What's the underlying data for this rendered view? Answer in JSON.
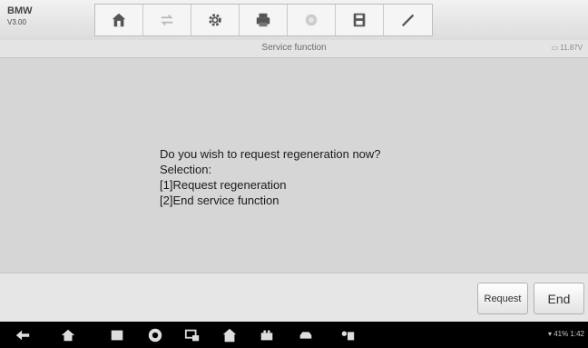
{
  "vehicle": {
    "make": "BMW",
    "version": "V3.00"
  },
  "toolbar": {
    "items": [
      {
        "name": "home"
      },
      {
        "name": "vehicle-swap"
      },
      {
        "name": "settings"
      },
      {
        "name": "print"
      },
      {
        "name": "help"
      },
      {
        "name": "save"
      },
      {
        "name": "edit"
      }
    ]
  },
  "header": {
    "title": "Service function",
    "battery": "11.87V"
  },
  "message": {
    "lines": [
      "Do you wish to request regeneration now?",
      "Selection:",
      "[1]Request regeneration",
      "[2]End service function"
    ]
  },
  "buttons": {
    "request": "Request",
    "end": "End"
  },
  "navbar": {
    "status": "41%  1:42"
  },
  "colors": {
    "toolbar_icon": "#555555",
    "disabled_icon": "#bbbbbb",
    "navbar": "#000000"
  }
}
